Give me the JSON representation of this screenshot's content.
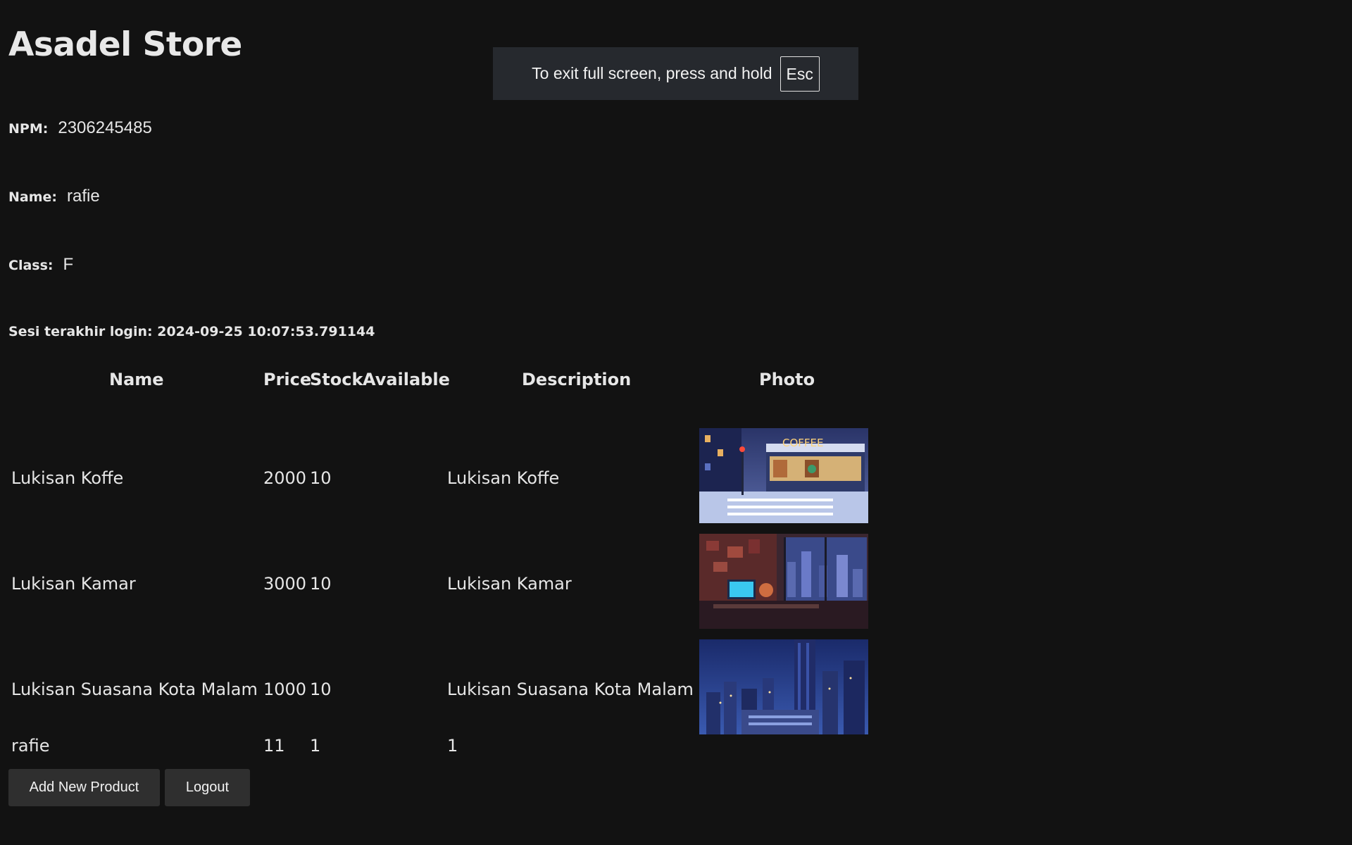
{
  "store": {
    "title": "Asadel Store"
  },
  "fullscreen_notice": {
    "text": "To exit full screen, press and hold",
    "key": "Esc"
  },
  "user": {
    "npm_label": "NPM:",
    "npm": "2306245485",
    "name_label": "Name:",
    "name": "rafie",
    "class_label": "Class:",
    "class": "F"
  },
  "last_login": "Sesi terakhir login: 2024-09-25 10:07:53.791144",
  "table": {
    "headers": {
      "name": "Name",
      "price": "Price",
      "stock": "Stock",
      "available": "Available",
      "description": "Description",
      "photo": "Photo"
    },
    "rows": [
      {
        "name": "Lukisan Koffe",
        "price": "2000",
        "stock": "10",
        "available": "",
        "description": "Lukisan Koffe",
        "photo": "coffee-shop-night-painting"
      },
      {
        "name": "Lukisan Kamar",
        "price": "3000",
        "stock": "10",
        "available": "",
        "description": "Lukisan Kamar",
        "photo": "cozy-room-city-view-painting"
      },
      {
        "name": "Lukisan Suasana Kota Malam",
        "price": "1000",
        "stock": "10",
        "available": "",
        "description": "Lukisan Suasana Kota Malam",
        "photo": "night-city-skyline-painting"
      },
      {
        "name": "rafie",
        "price": "11",
        "stock": "1",
        "available": "",
        "description": "1",
        "photo": ""
      }
    ]
  },
  "buttons": {
    "add": "Add New Product",
    "logout": "Logout"
  },
  "colors": {
    "background": "#121212",
    "text": "#e6e6e6",
    "button": "#2f2f2f",
    "toast": "#26292e"
  }
}
